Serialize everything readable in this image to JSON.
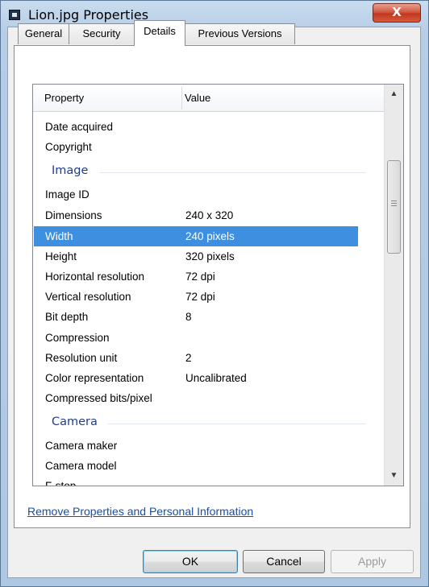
{
  "window": {
    "title": "Lion.jpg Properties",
    "close_label": "X"
  },
  "tabs": [
    {
      "label": "General"
    },
    {
      "label": "Security"
    },
    {
      "label": "Details"
    },
    {
      "label": "Previous Versions"
    }
  ],
  "details": {
    "columns": {
      "property": "Property",
      "value": "Value"
    },
    "rows": [
      {
        "property": "Date acquired",
        "value": ""
      },
      {
        "property": "Copyright",
        "value": ""
      },
      {
        "group": "Image"
      },
      {
        "property": "Image ID",
        "value": ""
      },
      {
        "property": "Dimensions",
        "value": "240 x 320"
      },
      {
        "property": "Width",
        "value": "240 pixels"
      },
      {
        "property": "Height",
        "value": "320 pixels"
      },
      {
        "property": "Horizontal resolution",
        "value": "72 dpi"
      },
      {
        "property": "Vertical resolution",
        "value": "72 dpi"
      },
      {
        "property": "Bit depth",
        "value": "8"
      },
      {
        "property": "Compression",
        "value": ""
      },
      {
        "property": "Resolution unit",
        "value": "2"
      },
      {
        "property": "Color representation",
        "value": "Uncalibrated"
      },
      {
        "property": "Compressed bits/pixel",
        "value": ""
      },
      {
        "group": "Camera"
      },
      {
        "property": "Camera maker",
        "value": ""
      },
      {
        "property": "Camera model",
        "value": ""
      },
      {
        "property": "F-stop",
        "value": ""
      }
    ]
  },
  "link": {
    "label": "Remove Properties and Personal Information"
  },
  "buttons": {
    "ok": "OK",
    "cancel": "Cancel",
    "apply": "Apply"
  },
  "colors": {
    "selection": "#3f8fe0",
    "group_header": "#1f3f8a",
    "link": "#1450aa"
  }
}
